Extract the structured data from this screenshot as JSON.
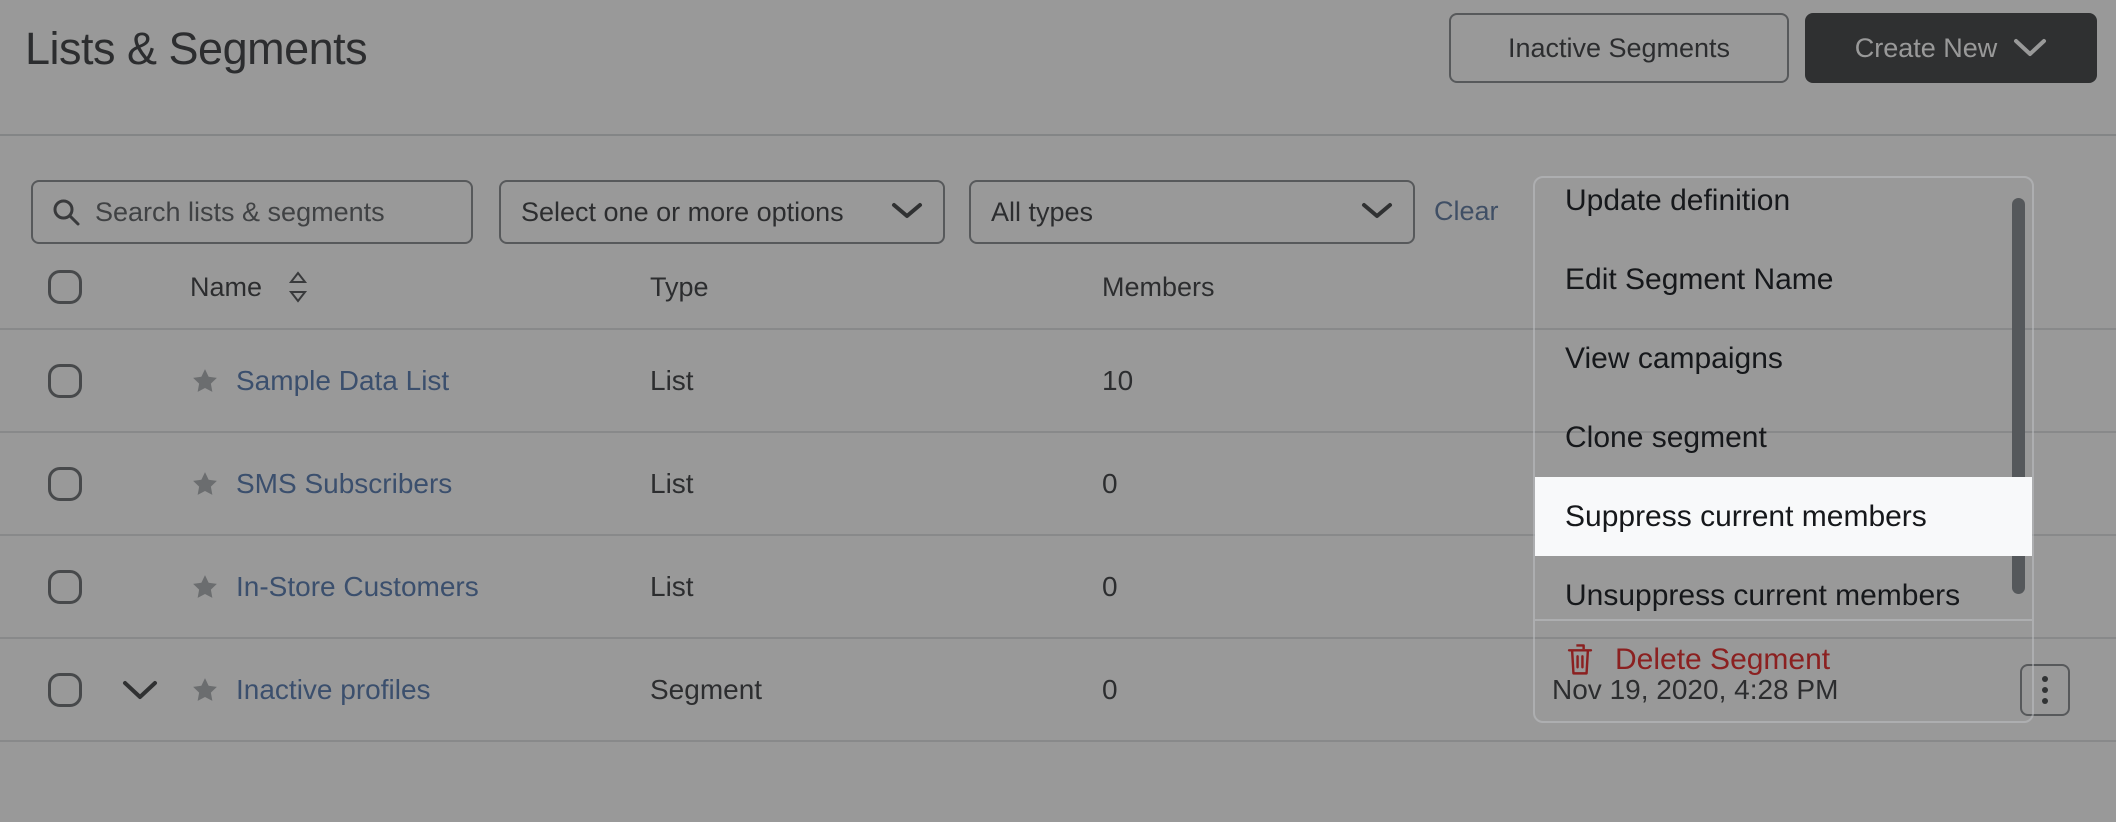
{
  "header": {
    "title": "Lists & Segments",
    "inactive_segments_label": "Inactive Segments",
    "create_new_label": "Create New"
  },
  "filters": {
    "search_placeholder": "Search lists & segments",
    "search_value": "",
    "options_select_label": "Select one or more options",
    "types_select_label": "All types",
    "clear_label": "Clear"
  },
  "table": {
    "columns": {
      "name": "Name",
      "type": "Type",
      "members": "Members"
    },
    "rows": [
      {
        "name": "Sample Data List",
        "type": "List",
        "members": "10",
        "date": ""
      },
      {
        "name": "SMS Subscribers",
        "type": "List",
        "members": "0",
        "date": ""
      },
      {
        "name": "In-Store Customers",
        "type": "List",
        "members": "0",
        "date": ""
      },
      {
        "name": "Inactive profiles",
        "type": "Segment",
        "members": "0",
        "date": "Nov 19, 2020, 4:28 PM"
      }
    ]
  },
  "context_menu": {
    "items": [
      "Update definition",
      "Edit Segment Name",
      "View campaigns",
      "Clone segment",
      "Suppress current members",
      "Unsuppress current members"
    ],
    "highlighted_item": "Suppress current members",
    "delete_label": "Delete Segment"
  },
  "colors": {
    "accent_link": "#2f5c9e",
    "danger": "#8b2020",
    "primary_button_bg": "#14171a",
    "clear_link": "#3a5b8c"
  }
}
